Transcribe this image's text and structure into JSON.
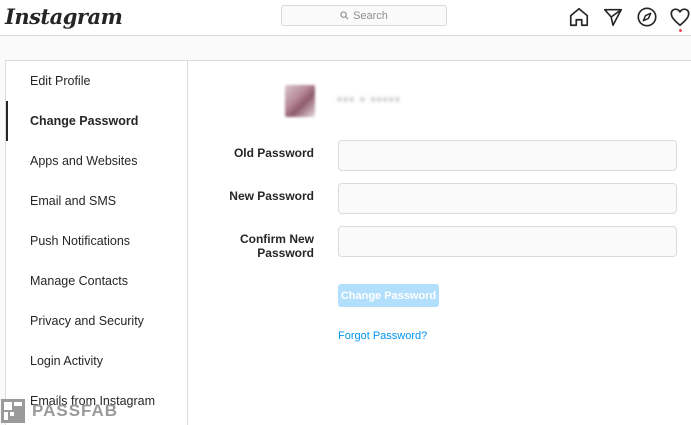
{
  "app": {
    "logo_text": "Instagram"
  },
  "search": {
    "placeholder": "Search",
    "icon": "search-icon"
  },
  "nav": {
    "icons": [
      "home-icon",
      "direct-message-icon",
      "explore-icon",
      "activity-heart-icon"
    ],
    "activity_indicator_color": "#ed4956"
  },
  "sidebar": {
    "items": [
      {
        "label": "Edit Profile",
        "active": false
      },
      {
        "label": "Change Password",
        "active": true
      },
      {
        "label": "Apps and Websites",
        "active": false
      },
      {
        "label": "Email and SMS",
        "active": false
      },
      {
        "label": "Push Notifications",
        "active": false
      },
      {
        "label": "Manage Contacts",
        "active": false
      },
      {
        "label": "Privacy and Security",
        "active": false
      },
      {
        "label": "Login Activity",
        "active": false
      },
      {
        "label": "Emails from Instagram",
        "active": false
      }
    ]
  },
  "profile": {
    "username_blurred": "*** * *****"
  },
  "form": {
    "old_password_label": "Old Password",
    "new_password_label": "New Password",
    "confirm_label_line1": "Confirm New",
    "confirm_label_line2": "Password",
    "old_password_value": "",
    "new_password_value": "",
    "confirm_password_value": "",
    "submit_label": "Change Password",
    "forgot_label": "Forgot Password?"
  },
  "watermark": {
    "text": "PASSFAB"
  },
  "colors": {
    "accent_link": "#0095f6",
    "button_disabled": "#b2dffc",
    "border": "#dbdbdb",
    "background": "#fafafa"
  }
}
